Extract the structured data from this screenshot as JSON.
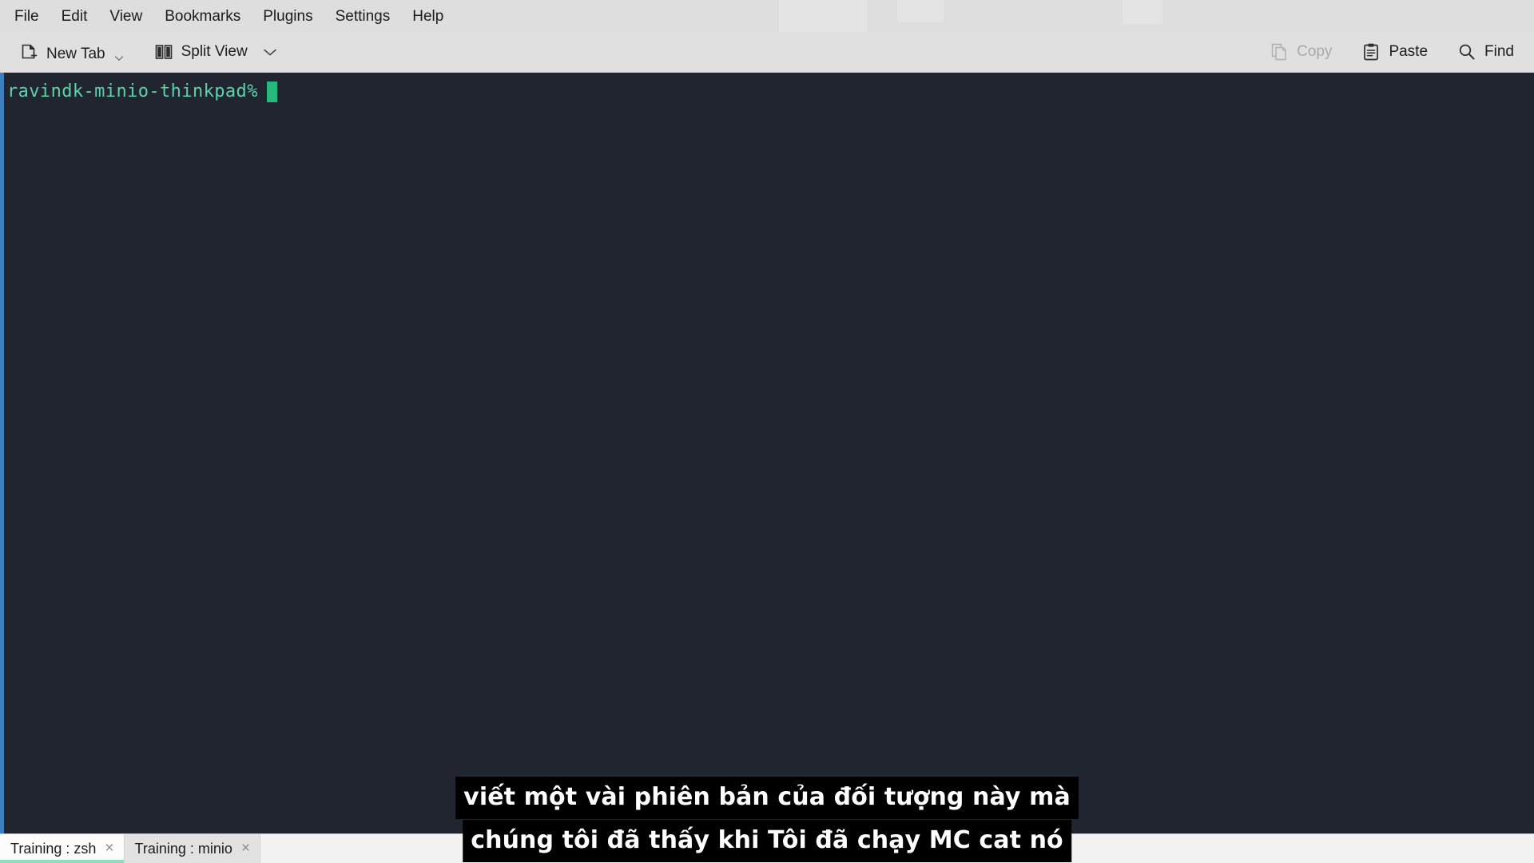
{
  "window": {
    "terminal_bg": "#212530",
    "chrome_bg": "#dedede",
    "accent": "#8fdcc0",
    "focus_bar": "#3d7fc1"
  },
  "menubar": {
    "items": [
      {
        "label": "File"
      },
      {
        "label": "Edit"
      },
      {
        "label": "View"
      },
      {
        "label": "Bookmarks"
      },
      {
        "label": "Plugins"
      },
      {
        "label": "Settings"
      },
      {
        "label": "Help"
      }
    ]
  },
  "toolbar": {
    "left": [
      {
        "label": "New Tab",
        "icon": "new-tab-icon",
        "has_chevron": true,
        "disabled": false
      },
      {
        "label": "Split View",
        "icon": "split-view-icon",
        "has_chevron": true,
        "disabled": false
      }
    ],
    "right": [
      {
        "label": "Copy",
        "icon": "copy-icon",
        "disabled": true
      },
      {
        "label": "Paste",
        "icon": "paste-icon",
        "disabled": false
      },
      {
        "label": "Find",
        "icon": "search-icon",
        "disabled": false
      }
    ]
  },
  "terminal": {
    "prompt": "ravindk-minio-thinkpad%",
    "prompt_color": "#5fd0ab",
    "cursor_color": "#25b97c",
    "command": ""
  },
  "subtitle": {
    "line1": "viết một vài phiên bản của đối tượng này mà",
    "line2": "chúng tôi đã thấy khi Tôi đã chạy MC cat nó"
  },
  "tabbar": {
    "tabs": [
      {
        "label": "Training : zsh",
        "active": true,
        "close": "×"
      },
      {
        "label": "Training : minio",
        "active": false,
        "close": "×"
      }
    ]
  }
}
